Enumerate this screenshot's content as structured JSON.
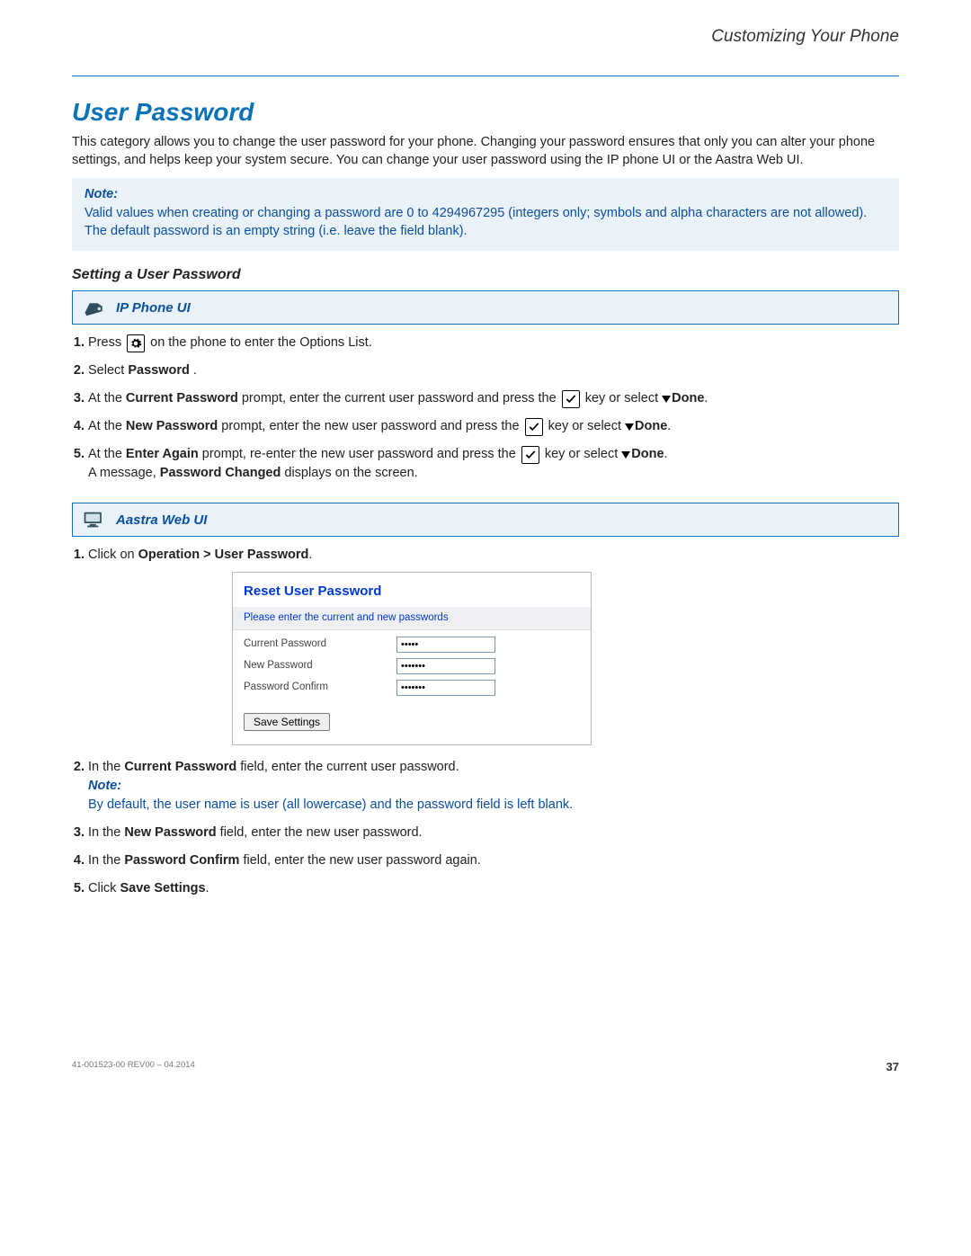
{
  "header": {
    "running": "Customizing Your Phone"
  },
  "title": "User Password",
  "intro": "This category allows you to change the user password for your phone. Changing your password ensures that only you can alter your phone settings, and helps keep your system secure. You can change your user password using the IP phone UI or the Aastra Web UI.",
  "note": {
    "label": "Note:",
    "body": "Valid values when creating or changing a password are 0 to 4294967295 (integers only; symbols and alpha characters are not allowed). The default password is an empty string (i.e. leave the field blank)."
  },
  "sub_heading": "Setting a User Password",
  "bar_phone": "IP Phone UI",
  "bar_web": "Aastra Web UI",
  "phone_steps": {
    "s1a": "Press ",
    "s1b": " on the phone to enter the Options List.",
    "s2a": "Select ",
    "s2b": "Password",
    "s2c": " .",
    "s3a": "At the ",
    "s3b": "Current Password",
    "s3c": " prompt, enter the current user password and press the ",
    "s3d": " key or select ",
    "s3e": "Done",
    "s3f": ".",
    "s4a": "At the ",
    "s4b": "New Password",
    "s4c": " prompt, enter the new user password and press the ",
    "s4d": " key or select ",
    "s4e": "Done",
    "s4f": ".",
    "s5a": "At the ",
    "s5b": "Enter Again",
    "s5c": " prompt, re-enter the new user password and press the ",
    "s5d": " key or select ",
    "s5e": "Done",
    "s5f": ".",
    "s5g": "A message, ",
    "s5h": "Password Changed",
    "s5i": " displays on the screen."
  },
  "web_steps": {
    "s1a": "Click on ",
    "s1b": "Operation > User Password",
    "s1c": ".",
    "s2a": "In the ",
    "s2b": "Current Password",
    "s2c": " field, enter the current user password.",
    "s2_note_label": "Note:",
    "s2_note_body": "By default, the user name is user (all lowercase) and the password field is left blank.",
    "s3a": "In the ",
    "s3b": "New Password",
    "s3c": " field, enter the new user password.",
    "s4a": "In the ",
    "s4b": "Password Confirm",
    "s4c": " field, enter the new user password again.",
    "s5a": "Click ",
    "s5b": "Save Settings",
    "s5c": "."
  },
  "screenshot": {
    "title": "Reset User Password",
    "subtitle": "Please enter the current and new passwords",
    "rows": {
      "r1": "Current Password",
      "r2": "New Password",
      "r3": "Password Confirm"
    },
    "values": {
      "v1": "•••••",
      "v2": "•••••••",
      "v3": "•••••••"
    },
    "save": "Save Settings"
  },
  "footer": {
    "rev": "41-001523-00 REV00 – 04.2014",
    "page": "37"
  }
}
